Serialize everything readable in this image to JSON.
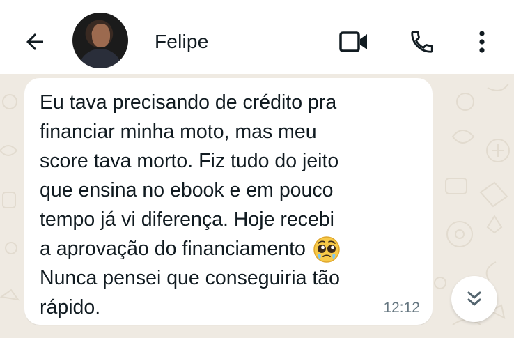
{
  "header": {
    "contact_name": "Felipe",
    "back_icon": "arrow-left-icon",
    "video_icon": "video-camera-icon",
    "call_icon": "phone-icon",
    "menu_icon": "more-vertical-icon"
  },
  "message": {
    "lines": [
      "Eu tava precisando de crédito pra",
      "financiar minha moto, mas meu",
      "score tava morto. Fiz tudo do jeito",
      "que ensina no ebook e em pouco",
      "tempo já vi diferença. Hoje recebi",
      "a aprovação do financiamento",
      "Nunca pensei que conseguiria tão",
      "rápido."
    ],
    "emoji": "pleading-face-emoji",
    "time": "12:12"
  },
  "scroll_button": {
    "icon": "double-chevron-down-icon"
  },
  "colors": {
    "header_bg": "#ffffff",
    "chat_bg": "#efeae2",
    "bubble_bg": "#ffffff",
    "text": "#111b21",
    "timestamp": "#667781"
  }
}
